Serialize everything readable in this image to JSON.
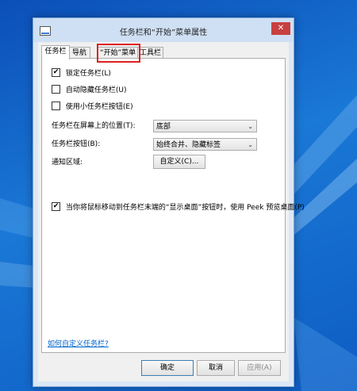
{
  "window": {
    "title": "任务栏和“开始”菜单属性",
    "close_label": "✕"
  },
  "tabs": [
    {
      "label": "任务栏"
    },
    {
      "label": "导航"
    },
    {
      "label": "“开始”菜单"
    },
    {
      "label": "工具栏"
    }
  ],
  "taskbar_tab": {
    "lock_taskbar": {
      "label": "锁定任务栏(L)",
      "checked": true
    },
    "auto_hide": {
      "label": "自动隐藏任务栏(U)",
      "checked": false
    },
    "small_buttons": {
      "label": "使用小任务栏按钮(E)",
      "checked": false
    },
    "location_label": "任务栏在屏幕上的位置(T):",
    "location_value": "底部",
    "buttons_label": "任务栏按钮(B):",
    "buttons_value": "始终合并、隐藏标签",
    "notification_label": "通知区域:",
    "customize_button": "自定义(C)...",
    "peek": {
      "label": "当你将鼠标移动到任务栏末端的“显示桌面”按钮时，使用 Peek 预览桌面(P)",
      "checked": true
    },
    "help_link": "如何自定义任务栏?"
  },
  "footer": {
    "ok": "确定",
    "cancel": "取消",
    "apply": "应用(A)"
  },
  "colors": {
    "desktop": "#1a78d6",
    "close_button": "#c84040",
    "highlight": "#e02020",
    "link": "#0066cc"
  },
  "icons": {
    "checkbox_check": "✔",
    "dropdown_chevron": "⌄"
  }
}
